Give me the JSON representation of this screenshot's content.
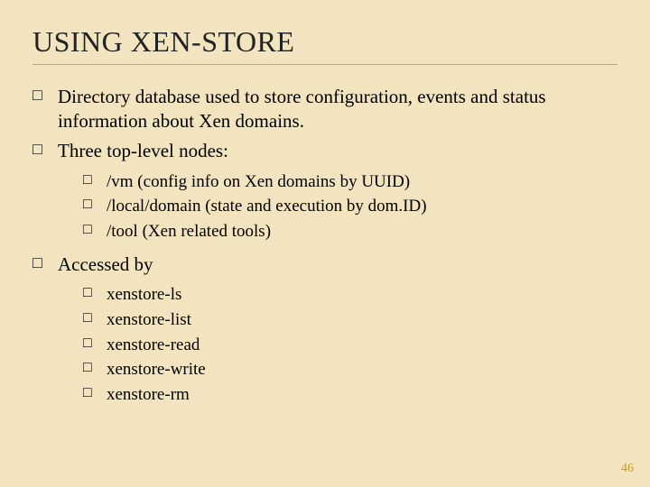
{
  "title": "USING XEN-STORE",
  "bullets": [
    {
      "text": "Directory database used to store configuration, events and status information about Xen domains."
    },
    {
      "text": "Three top-level nodes:",
      "children": [
        {
          "text": "/vm (config info on Xen domains by UUID)"
        },
        {
          "text": "/local/domain (state and execution by dom.ID)"
        },
        {
          "text": "/tool (Xen related tools)"
        }
      ]
    },
    {
      "text": "Accessed by",
      "children": [
        {
          "text": "xenstore-ls"
        },
        {
          "text": "xenstore-list"
        },
        {
          "text": "xenstore-read"
        },
        {
          "text": "xenstore-write"
        },
        {
          "text": "xenstore-rm"
        }
      ]
    }
  ],
  "page_number": "46"
}
